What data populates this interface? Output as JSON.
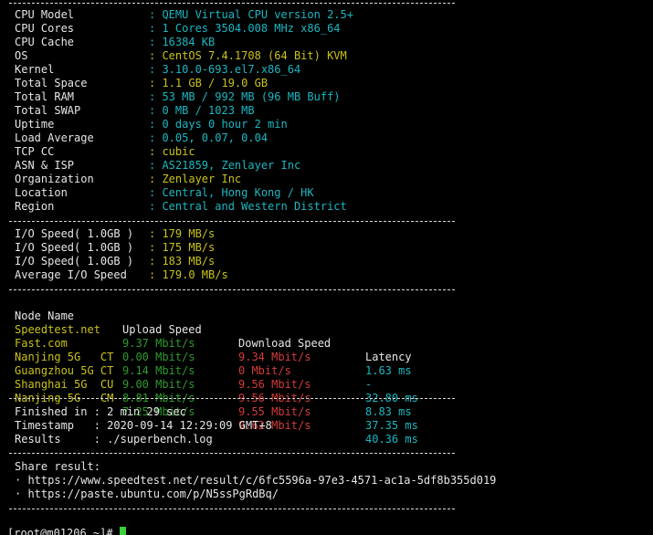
{
  "sys": [
    {
      "label": "CPU Model",
      "value": "QEMU Virtual CPU version 2.5+"
    },
    {
      "label": "CPU Cores",
      "value": "1 Cores 3504.008 MHz x86_64"
    },
    {
      "label": "CPU Cache",
      "value": "16384 KB"
    },
    {
      "label": "OS",
      "value": "CentOS 7.4.1708 (64 Bit) KVM"
    },
    {
      "label": "Kernel",
      "value": "3.10.0-693.el7.x86_64"
    },
    {
      "label": "Total Space",
      "value": "1.1 GB / 19.0 GB"
    },
    {
      "label": "Total RAM",
      "value": "53 MB / 992 MB (96 MB Buff)"
    },
    {
      "label": "Total SWAP",
      "value": "0 MB / 1023 MB"
    },
    {
      "label": "Uptime",
      "value": "0 days 0 hour 2 min"
    },
    {
      "label": "Load Average",
      "value": "0.05, 0.07, 0.04"
    },
    {
      "label": "TCP CC",
      "value": "cubic"
    },
    {
      "label": "ASN & ISP",
      "value": "AS21859, Zenlayer Inc"
    },
    {
      "label": "Organization",
      "value": "Zenlayer Inc"
    },
    {
      "label": "Location",
      "value": "Central, Hong Kong / HK"
    },
    {
      "label": "Region",
      "value": "Central and Western District"
    }
  ],
  "io": [
    {
      "label": "I/O Speed( 1.0GB )",
      "value": "179 MB/s"
    },
    {
      "label": "I/O Speed( 1.0GB )",
      "value": "175 MB/s"
    },
    {
      "label": "I/O Speed( 1.0GB )",
      "value": "183 MB/s"
    },
    {
      "label": "Average I/O Speed",
      "value": "179.0 MB/s"
    }
  ],
  "speed_header": {
    "node": "Node Name",
    "upload": "Upload Speed",
    "download": "Download Speed",
    "latency": "Latency"
  },
  "speed": [
    {
      "node": "Speedtest.net",
      "upload": "9.37 Mbit/s",
      "download": "9.34 Mbit/s",
      "latency": "1.63 ms"
    },
    {
      "node": "Fast.com",
      "upload": "0.00 Mbit/s",
      "download": "0 Mbit/s",
      "latency": "-"
    },
    {
      "node": "Nanjing 5G   CT",
      "upload": "9.14 Mbit/s",
      "download": "9.56 Mbit/s",
      "latency": "32.80 ms"
    },
    {
      "node": "Guangzhou 5G CT",
      "upload": "9.00 Mbit/s",
      "download": "9.56 Mbit/s",
      "latency": "8.83 ms"
    },
    {
      "node": "Shanghai 5G  CU",
      "upload": "8.81 Mbit/s",
      "download": "9.55 Mbit/s",
      "latency": "37.35 ms"
    },
    {
      "node": "Nanjing 5G   CM",
      "upload": "7.25 Mbit/s",
      "download": "9.62 Mbit/s",
      "latency": "40.36 ms"
    }
  ],
  "summary": [
    {
      "label": "Finished in ",
      "value": "2 min 29 sec"
    },
    {
      "label": "Timestamp   ",
      "value": "2020-09-14 12:29:09 GMT+8"
    },
    {
      "label": "Results     ",
      "value": "./superbench.log"
    }
  ],
  "share": {
    "title": "Share result:",
    "links": [
      "· https://www.speedtest.net/result/c/6fc5596a-97e3-4571-ac1a-5df8b355d019",
      "· https://paste.ubuntu.com/p/N5ssPgRdBq/"
    ]
  },
  "prompt": "[root@m01206 ~]# ",
  "colors": {
    "background": "#000000",
    "text": "#e6e6e6",
    "cyan": "#1ab7c2",
    "yellow": "#c9c21a",
    "green": "#2e9a2e",
    "red": "#d63a3a",
    "cursor": "#39d039"
  }
}
